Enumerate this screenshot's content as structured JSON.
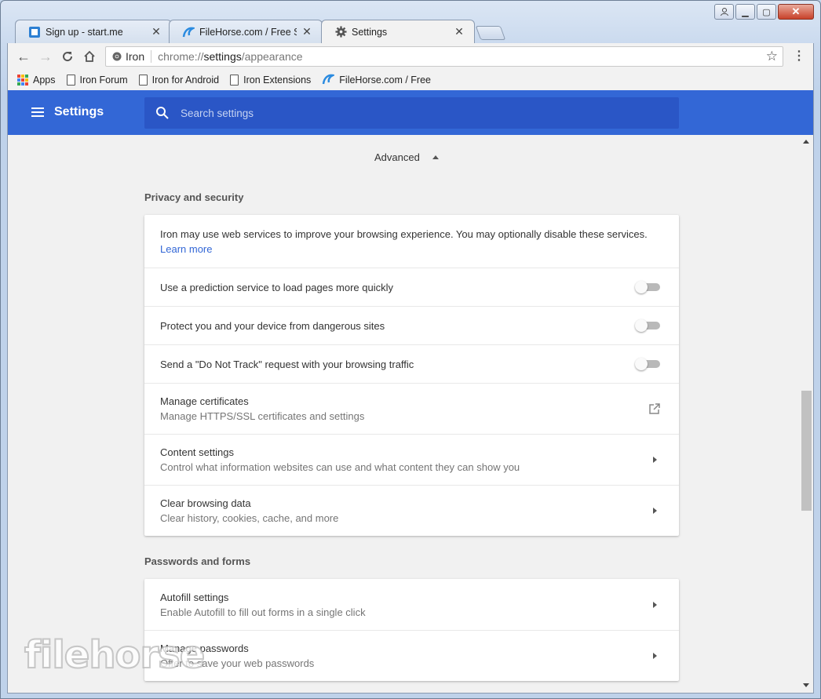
{
  "window": {
    "controls": {
      "minimize": "▁",
      "maximize": "▢",
      "close": "✕"
    }
  },
  "tabs": [
    {
      "title": "Sign up - start.me",
      "icon": "startme-favicon",
      "close": "✕",
      "active": false
    },
    {
      "title": "FileHorse.com / Free Soft",
      "icon": "filehorse-favicon",
      "close": "✕",
      "active": false
    },
    {
      "title": "Settings",
      "icon": "gear-icon",
      "close": "✕",
      "active": true
    }
  ],
  "toolbar": {
    "back": "←",
    "forward": "→",
    "reload": "C",
    "home": "⌂",
    "omnibox": {
      "chip_label": "Iron",
      "url_scheme": "chrome://",
      "url_host": "settings",
      "url_path": "/appearance"
    },
    "star": "☆",
    "menu": "⋮"
  },
  "bookmarks": [
    {
      "label": "Apps",
      "icon": "apps-grid-icon"
    },
    {
      "label": "Iron Forum",
      "icon": "page-icon"
    },
    {
      "label": "Iron for Android",
      "icon": "page-icon"
    },
    {
      "label": "Iron Extensions",
      "icon": "page-icon"
    },
    {
      "label": "FileHorse.com / Free",
      "icon": "filehorse-favicon"
    }
  ],
  "settings": {
    "title": "Settings",
    "search_placeholder": "Search settings",
    "advanced_label": "Advanced",
    "privacy": {
      "title": "Privacy and security",
      "intro": "Iron may use web services to improve your browsing experience. You may optionally disable these services.",
      "learn_more": "Learn more",
      "toggles": [
        {
          "label": "Use a prediction service to load pages more quickly",
          "on": false
        },
        {
          "label": "Protect you and your device from dangerous sites",
          "on": false
        },
        {
          "label": "Send a \"Do Not Track\" request with your browsing traffic",
          "on": false
        }
      ],
      "certificates": {
        "title": "Manage certificates",
        "subtitle": "Manage HTTPS/SSL certificates and settings"
      },
      "content": {
        "title": "Content settings",
        "subtitle": "Control what information websites can use and what content they can show you"
      },
      "clear": {
        "title": "Clear browsing data",
        "subtitle": "Clear history, cookies, cache, and more"
      }
    },
    "passwords": {
      "title": "Passwords and forms",
      "autofill": {
        "title": "Autofill settings",
        "subtitle": "Enable Autofill to fill out forms in a single click"
      },
      "manage": {
        "title": "Manage passwords",
        "subtitle": "Offer to save your web passwords"
      }
    }
  },
  "watermark": "filehorse",
  "colors": {
    "accent": "#3367d6",
    "search_bg": "#2a56c6",
    "page_bg": "#f1f1f1",
    "link": "#3367d6"
  }
}
